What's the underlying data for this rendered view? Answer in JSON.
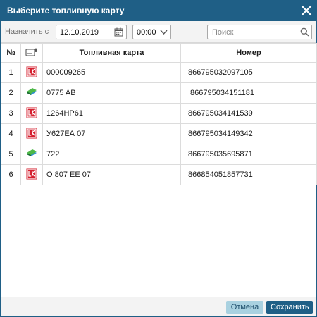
{
  "window": {
    "title": "Выберите топливную карту"
  },
  "toolbar": {
    "assign_label": "Назначить с",
    "date_value": "12.10.2019",
    "time_value": "00:00",
    "search_placeholder": "Поиск"
  },
  "table": {
    "headers": [
      "№",
      "",
      "Топливная карта",
      "Номер"
    ],
    "rows": [
      {
        "n": "1",
        "brand": "lukoil",
        "card": "000009265",
        "number": "866795032097105"
      },
      {
        "n": "2",
        "brand": "green-card",
        "card": "0775 AB",
        "number": " 866795034151181"
      },
      {
        "n": "3",
        "brand": "lukoil",
        "card": "1264НР61",
        "number": "866795034141539"
      },
      {
        "n": "4",
        "brand": "lukoil",
        "card": "У627ЕА 07",
        "number": "866795034149342"
      },
      {
        "n": "5",
        "brand": "green-card",
        "card": "722",
        "number": "866795035695871"
      },
      {
        "n": "6",
        "brand": "lukoil",
        "card": "О 807 ЕЕ 07",
        "number": "866854051857731"
      }
    ]
  },
  "footer": {
    "cancel_label": "Отмена",
    "save_label": "Сохранить"
  },
  "colors": {
    "accent": "#1f5f86",
    "lukoil_red": "#d5202f",
    "cancel_bg": "#a9d1e0"
  }
}
